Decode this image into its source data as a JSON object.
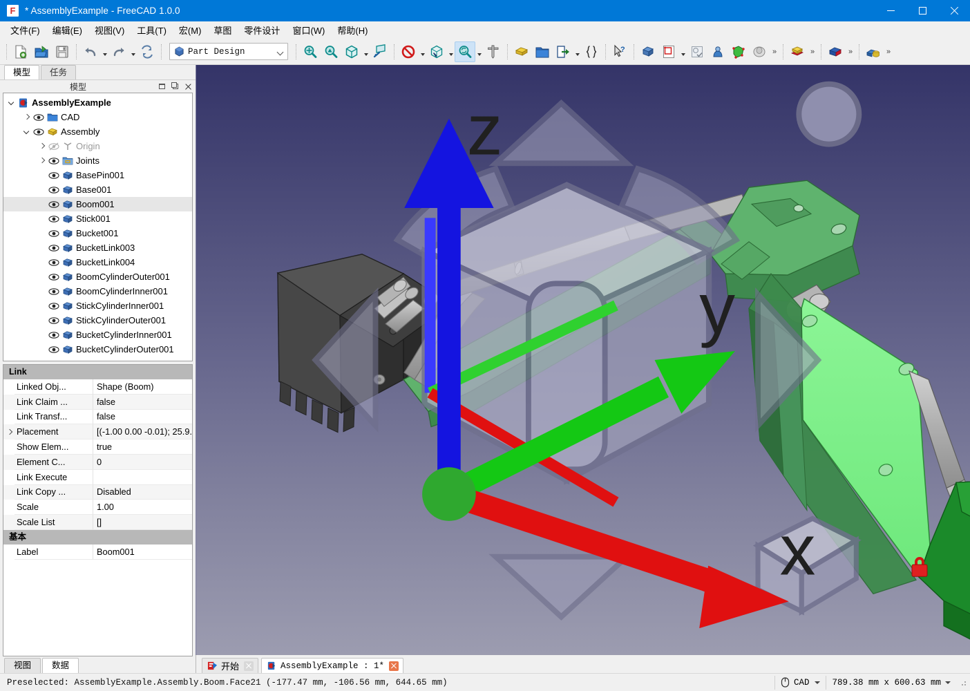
{
  "window": {
    "title": "* AssemblyExample - FreeCAD 1.0.0",
    "app_icon": "freecad-logo-icon",
    "minimize_label": "",
    "maximize_label": "",
    "close_label": ""
  },
  "menubar": {
    "items": [
      {
        "label": "文件(F)",
        "name": "menu-file"
      },
      {
        "label": "编辑(E)",
        "name": "menu-edit"
      },
      {
        "label": "视图(V)",
        "name": "menu-view"
      },
      {
        "label": "工具(T)",
        "name": "menu-tools"
      },
      {
        "label": "宏(M)",
        "name": "menu-macro"
      },
      {
        "label": "草图",
        "name": "menu-sketch"
      },
      {
        "label": "零件设计",
        "name": "menu-partdesign"
      },
      {
        "label": "窗口(W)",
        "name": "menu-window"
      },
      {
        "label": "帮助(H)",
        "name": "menu-help"
      }
    ]
  },
  "toolbar": {
    "workbench": {
      "value": "Part Design",
      "icon": "part-design-icon"
    },
    "buttons": [
      {
        "name": "new-document-button",
        "icon": "new-doc-icon"
      },
      {
        "name": "open-document-button",
        "icon": "open-folder-icon"
      },
      {
        "name": "save-document-button",
        "icon": "save-floppy-icon"
      },
      {
        "name": "undo-button",
        "icon": "undo-arrow-icon"
      },
      {
        "name": "redo-button",
        "icon": "redo-arrow-icon"
      },
      {
        "name": "refresh-button",
        "icon": "refresh-icon"
      },
      {
        "name": "fit-all-button",
        "icon": "zoom-fit-all-icon"
      },
      {
        "name": "fit-selection-button",
        "icon": "zoom-fit-selection-icon"
      },
      {
        "name": "axonometric-view-button",
        "icon": "isometric-cube-icon"
      },
      {
        "name": "view-section-button",
        "icon": "clip-plane-icon"
      },
      {
        "name": "draw-style-button",
        "icon": "no-entry-icon"
      },
      {
        "name": "std-views-button",
        "icon": "view-cube-icon"
      },
      {
        "name": "zoom-select-button",
        "icon": "magnifier-refresh-icon"
      },
      {
        "name": "measure-button",
        "icon": "caliper-icon"
      },
      {
        "name": "create-part-button",
        "icon": "yellow-part-icon"
      },
      {
        "name": "create-group-button",
        "icon": "blue-folder-icon"
      },
      {
        "name": "make-link-button",
        "icon": "link-export-icon"
      },
      {
        "name": "expression-button",
        "icon": "curly-braces-icon"
      },
      {
        "name": "whats-this-button",
        "icon": "cursor-question-icon"
      },
      {
        "name": "create-body-button",
        "icon": "body-icon"
      },
      {
        "name": "create-sketch-button",
        "icon": "sketch-icon"
      },
      {
        "name": "edit-sketch-button",
        "icon": "edit-sketch-icon"
      },
      {
        "name": "attachment-button",
        "icon": "attachment-icon"
      },
      {
        "name": "validate-sketch-button",
        "icon": "green-face-icon"
      },
      {
        "name": "map-sketch-button",
        "icon": "sheep-icon"
      },
      {
        "name": "pad-button",
        "icon": "pad-icon"
      },
      {
        "name": "pocket-button",
        "icon": "pocket-icon"
      },
      {
        "name": "boolean-button",
        "icon": "boolean-icon"
      }
    ],
    "overflow_label": "»"
  },
  "left_panel": {
    "tabs": [
      {
        "label": "模型",
        "name": "tab-model",
        "active": true
      },
      {
        "label": "任务",
        "name": "tab-tasks",
        "active": false
      }
    ],
    "dock_title": "模型",
    "dock_buttons": [
      "undock-icon",
      "float-icon",
      "close-icon"
    ],
    "tree": [
      {
        "label": "AssemblyExample",
        "indent": 0,
        "expander": "down",
        "eye": false,
        "icon": "document-icon",
        "bold": true,
        "selected": false,
        "dim": false
      },
      {
        "label": "CAD",
        "indent": 1,
        "expander": "right",
        "eye": true,
        "icon": "folder-icon",
        "bold": false,
        "selected": false,
        "dim": false
      },
      {
        "label": "Assembly",
        "indent": 1,
        "expander": "down",
        "eye": true,
        "icon": "assembly-icon",
        "bold": false,
        "selected": false,
        "dim": false
      },
      {
        "label": "Origin",
        "indent": 2,
        "expander": "right",
        "eye": "hidden",
        "icon": "origin-icon",
        "bold": false,
        "selected": false,
        "dim": true
      },
      {
        "label": "Joints",
        "indent": 2,
        "expander": "right",
        "eye": true,
        "icon": "joints-folder-icon",
        "bold": false,
        "selected": false,
        "dim": false
      },
      {
        "label": "BasePin001",
        "indent": 2,
        "expander": "none",
        "eye": true,
        "icon": "link-part-icon",
        "bold": false,
        "selected": false,
        "dim": false
      },
      {
        "label": "Base001",
        "indent": 2,
        "expander": "none",
        "eye": true,
        "icon": "link-part-icon",
        "bold": false,
        "selected": false,
        "dim": false
      },
      {
        "label": "Boom001",
        "indent": 2,
        "expander": "none",
        "eye": true,
        "icon": "link-part-icon",
        "bold": false,
        "selected": true,
        "dim": false
      },
      {
        "label": "Stick001",
        "indent": 2,
        "expander": "none",
        "eye": true,
        "icon": "link-part-icon",
        "bold": false,
        "selected": false,
        "dim": false
      },
      {
        "label": "Bucket001",
        "indent": 2,
        "expander": "none",
        "eye": true,
        "icon": "link-part-icon",
        "bold": false,
        "selected": false,
        "dim": false
      },
      {
        "label": "BucketLink003",
        "indent": 2,
        "expander": "none",
        "eye": true,
        "icon": "link-part-icon",
        "bold": false,
        "selected": false,
        "dim": false
      },
      {
        "label": "BucketLink004",
        "indent": 2,
        "expander": "none",
        "eye": true,
        "icon": "link-part-icon",
        "bold": false,
        "selected": false,
        "dim": false
      },
      {
        "label": "BoomCylinderOuter001",
        "indent": 2,
        "expander": "none",
        "eye": true,
        "icon": "link-part-icon",
        "bold": false,
        "selected": false,
        "dim": false
      },
      {
        "label": "BoomCylinderInner001",
        "indent": 2,
        "expander": "none",
        "eye": true,
        "icon": "link-part-icon",
        "bold": false,
        "selected": false,
        "dim": false
      },
      {
        "label": "StickCylinderInner001",
        "indent": 2,
        "expander": "none",
        "eye": true,
        "icon": "link-part-icon",
        "bold": false,
        "selected": false,
        "dim": false
      },
      {
        "label": "StickCylinderOuter001",
        "indent": 2,
        "expander": "none",
        "eye": true,
        "icon": "link-part-icon",
        "bold": false,
        "selected": false,
        "dim": false
      },
      {
        "label": "BucketCylinderInner001",
        "indent": 2,
        "expander": "none",
        "eye": true,
        "icon": "link-part-icon",
        "bold": false,
        "selected": false,
        "dim": false
      },
      {
        "label": "BucketCylinderOuter001",
        "indent": 2,
        "expander": "none",
        "eye": true,
        "icon": "link-part-icon",
        "bold": false,
        "selected": false,
        "dim": false
      }
    ],
    "properties": [
      {
        "group": "Link",
        "rows": [
          {
            "name": "Linked Obj...",
            "value": "Shape (Boom)",
            "expandable": false
          },
          {
            "name": "Link Claim ...",
            "value": "false",
            "expandable": false
          },
          {
            "name": "Link Transf...",
            "value": "false",
            "expandable": false
          },
          {
            "name": "Placement",
            "value": "[(-1.00 0.00 -0.01); 25.9...",
            "expandable": true
          },
          {
            "name": "Show Elem...",
            "value": "true",
            "expandable": false
          },
          {
            "name": "Element C...",
            "value": "0",
            "expandable": false
          },
          {
            "name": "Link Execute",
            "value": "",
            "expandable": false
          },
          {
            "name": "Link Copy ...",
            "value": "Disabled",
            "expandable": false
          },
          {
            "name": "Scale",
            "value": "1.00",
            "expandable": false
          },
          {
            "name": "Scale List",
            "value": "[]",
            "expandable": false
          }
        ]
      },
      {
        "group": "基本",
        "rows": [
          {
            "name": "Label",
            "value": "Boom001",
            "expandable": false
          }
        ]
      }
    ],
    "bottom_tabs": [
      {
        "label": "视图",
        "name": "tab-view-properties",
        "active": false
      },
      {
        "label": "数据",
        "name": "tab-data-properties",
        "active": true
      }
    ]
  },
  "viewport": {
    "navigation_cube": "navigation-cube",
    "axis_indicator": {
      "x_label": "x",
      "y_label": "y",
      "z_label": "z"
    },
    "colors": {
      "background_top": "#343468",
      "background_bottom": "#9c9cb0",
      "boom_highlight": "#80f08a",
      "boom_green": "#5cb36a",
      "base_dark_green": "#1f8b2c",
      "bucket_black": "#383838",
      "cylinder_grey": "#b4b4b4",
      "lock_badge": "#e02020"
    },
    "lock_badge": "lock-icon"
  },
  "document_tabs": [
    {
      "label": "开始",
      "icon": "freecad-start-icon",
      "active": false,
      "close_state": "grey",
      "cjk": true
    },
    {
      "label": "AssemblyExample : 1*",
      "icon": "document-icon",
      "active": true,
      "close_state": "red",
      "cjk": false
    }
  ],
  "statusbar": {
    "message": "Preselected: AssemblyExample.Assembly.Boom.Face21 (-177.47 mm, -106.56 mm, 644.65 mm)",
    "nav_style": "CAD",
    "nav_icon": "mouse-icon",
    "dimensions": "789.38 mm x 600.63 mm"
  }
}
